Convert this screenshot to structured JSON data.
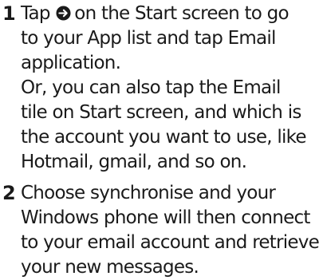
{
  "steps": [
    {
      "number": "1",
      "line1_before": "Tap",
      "icon": "arrow-right-circle-icon",
      "line1_after": "on the Start screen to go",
      "lines": [
        "to your App list and tap Email",
        "application.",
        "Or, you can also tap the Email",
        "tile on Start screen, and which is",
        "the account you want to use, like",
        "Hotmail, gmail, and so on."
      ]
    },
    {
      "number": "2",
      "lines": [
        "Choose synchronise and your",
        "Windows phone will then connect",
        "to your email account and retrieve",
        "your new messages."
      ]
    }
  ],
  "colors": {
    "text": "#1a1a1a",
    "icon_fill": "#1a1a1a",
    "icon_arrow": "#ffffff"
  }
}
